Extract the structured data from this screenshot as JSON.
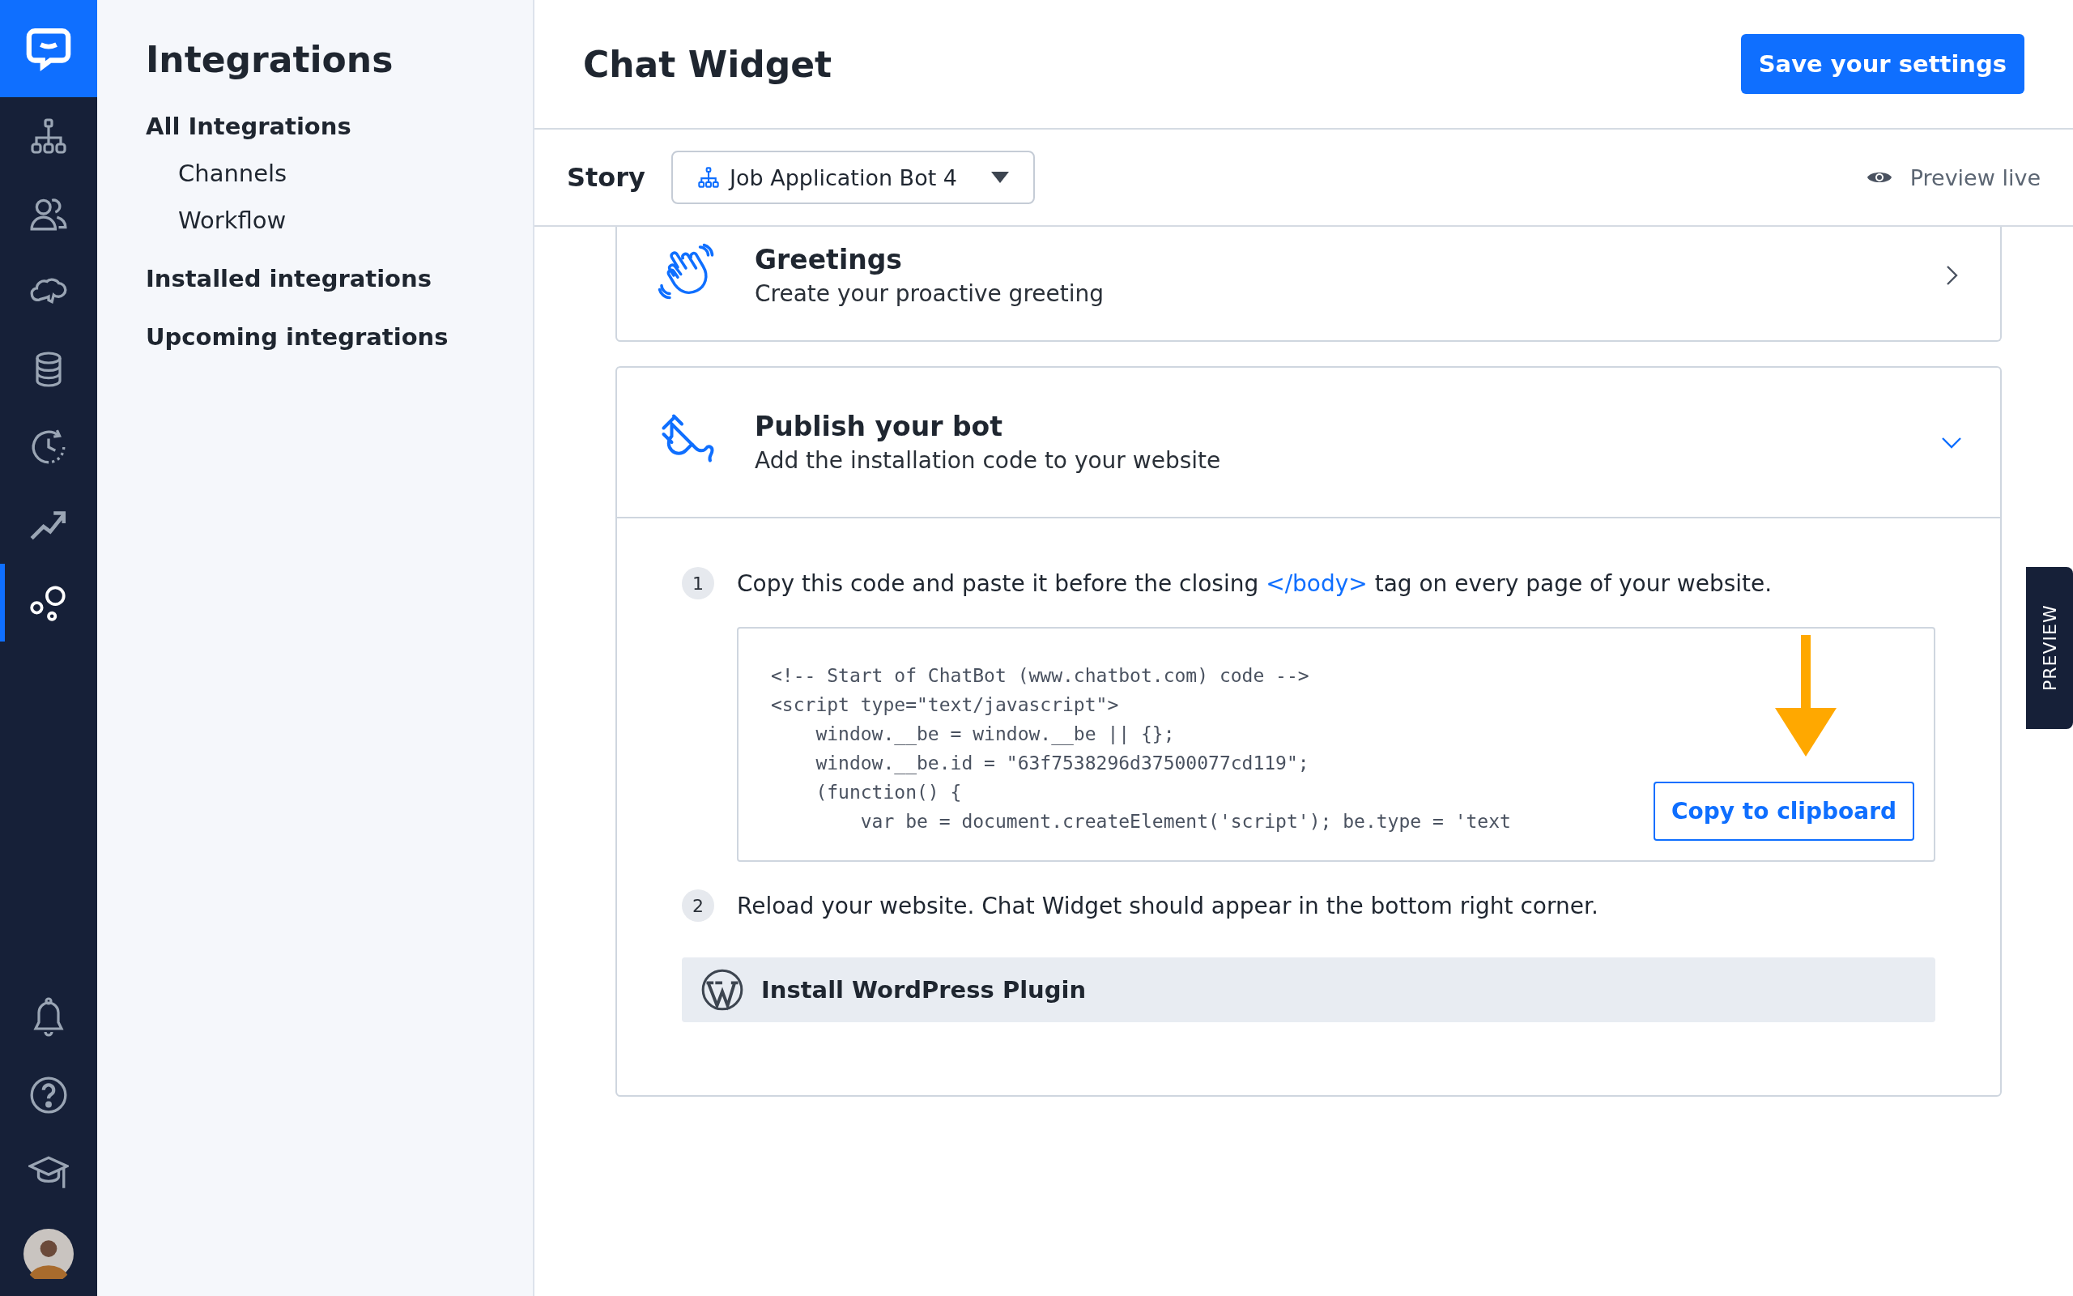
{
  "rail": {
    "items": [
      {
        "kind": "logo"
      },
      {
        "kind": "hierarchy",
        "selected": false
      },
      {
        "kind": "people",
        "selected": false
      },
      {
        "kind": "cloud",
        "selected": false
      },
      {
        "kind": "database",
        "selected": false
      },
      {
        "kind": "clock",
        "selected": false
      },
      {
        "kind": "trend",
        "selected": false
      },
      {
        "kind": "bubbles",
        "selected": true
      }
    ],
    "bottom": [
      {
        "kind": "bell"
      },
      {
        "kind": "help"
      },
      {
        "kind": "cap"
      },
      {
        "kind": "avatar"
      }
    ]
  },
  "sidebar": {
    "title": "Integrations",
    "items": [
      {
        "label": "All Integrations",
        "children": [
          {
            "label": "Channels"
          },
          {
            "label": "Workflow"
          }
        ]
      },
      {
        "label": "Installed integrations"
      },
      {
        "label": "Upcoming integrations"
      }
    ]
  },
  "header": {
    "title": "Chat Widget",
    "save_button": "Save your settings"
  },
  "story_bar": {
    "label": "Story",
    "dropdown": "Job Application Bot 4",
    "preview": "Preview live"
  },
  "sections": [
    {
      "kind": "greetings",
      "title": "Greetings",
      "subtitle": "Create your proactive greeting",
      "expanded": false
    },
    {
      "kind": "publish",
      "title": "Publish your bot",
      "subtitle": "Add the installation code to your website",
      "expanded": true
    }
  ],
  "steps": [
    {
      "number": "1",
      "text": "Copy this code and paste it before the closing ",
      "link": "</body>",
      "text_after": " tag on every page of your website."
    },
    {
      "number": "2",
      "text": "Reload your website. Chat Widget should appear in the bottom right corner."
    }
  ],
  "code": {
    "lines": [
      "<!-- Start of ChatBot (www.chatbot.com) code -->",
      "<script type=\"text/javascript\">",
      "    window.__be = window.__be || {};",
      "    window.__be.id = \"63f7538296d37500077cd119\";",
      "    (function() {",
      "        var be = document.createElement('script'); be.type = 'text"
    ],
    "copy_button": "Copy to clipboard"
  },
  "wordpress_button": "Install WordPress Plugin",
  "preview_tab": "PREVIEW"
}
